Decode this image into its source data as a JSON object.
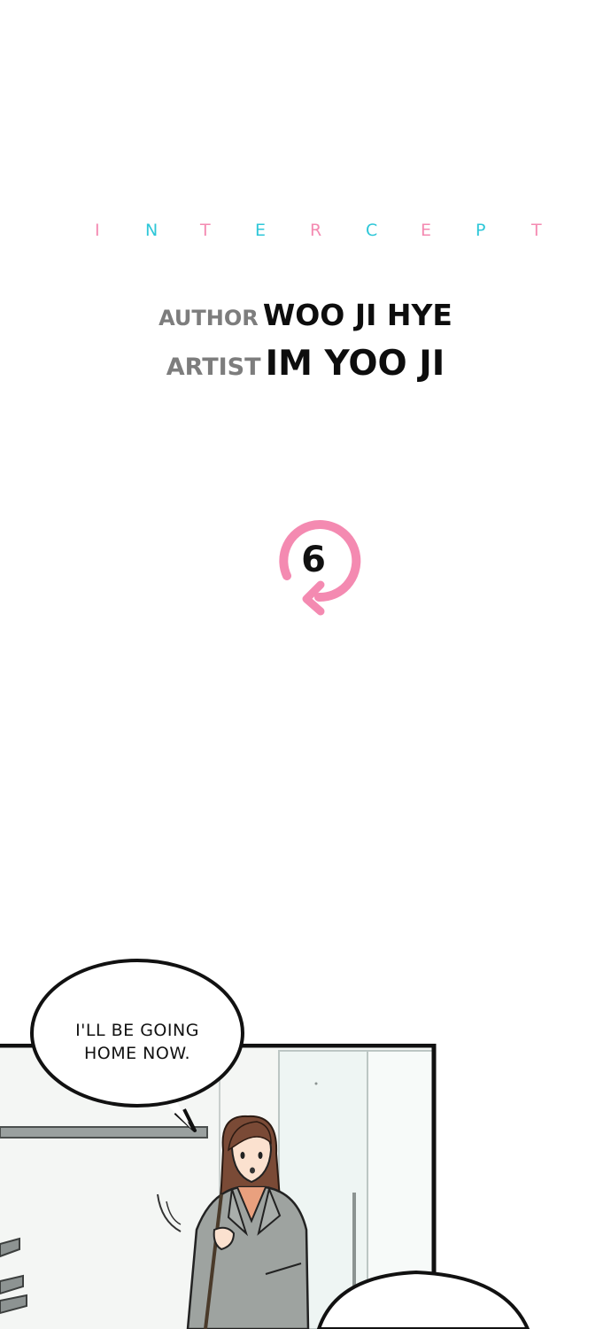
{
  "title": {
    "letters": [
      {
        "char": "I",
        "color": "#f48ab1"
      },
      {
        "char": "N",
        "color": "#2ec7d8"
      },
      {
        "char": "T",
        "color": "#f48ab1"
      },
      {
        "char": "E",
        "color": "#2ec7d8"
      },
      {
        "char": "R",
        "color": "#f48ab1"
      },
      {
        "char": "C",
        "color": "#2ec7d8"
      },
      {
        "char": "E",
        "color": "#f48ab1"
      },
      {
        "char": "P",
        "color": "#2ec7d8"
      },
      {
        "char": "T",
        "color": "#f48ab1"
      }
    ]
  },
  "credits": {
    "author_role": "AUTHOR",
    "author_name": "WOO JI HYE",
    "artist_role": "ARTIST",
    "artist_name": "IM YOO JI"
  },
  "chapter": {
    "number": "6",
    "accent_color": "#f48ab1"
  },
  "panel": {
    "speech_line_1": "I'LL BE GOING",
    "speech_line_2": "HOME NOW."
  }
}
